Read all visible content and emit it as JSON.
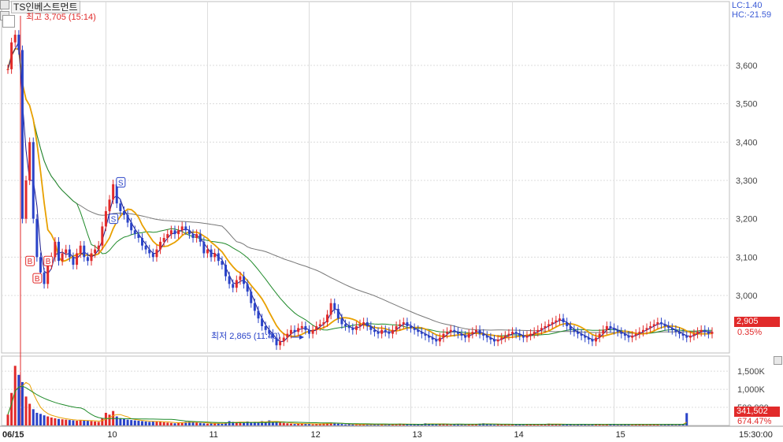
{
  "header": {
    "title": "TS인베스트먼트",
    "lc": "LC:1.40",
    "hc": "HC:-21.59"
  },
  "annotations": {
    "high": "최고 3,705 (15:14)",
    "low": "최저 2,865 (11:40)"
  },
  "price_panel": {
    "current_price": "2,905",
    "change_pct": "0.35%"
  },
  "volume_panel": {
    "current_volume": "341,502",
    "ratio_pct": "674.47%"
  },
  "colors": {
    "up": "#e12a2a",
    "down": "#2a43c8",
    "ma_short": "#1a1a8c",
    "ma_mid": "#e8a000",
    "ma_long": "#1f8a2a",
    "ma_longest": "#777777",
    "grid": "#dcdcdc"
  },
  "chart_data": [
    {
      "type": "line",
      "title": "TS인베스트먼트",
      "y_ticks": [
        3000,
        3100,
        3200,
        3300,
        3400,
        3500,
        3600
      ],
      "y_tick_labels": [
        "3,000",
        "3,100",
        "3,200",
        "3,300",
        "3,400",
        "3,500",
        "3,600"
      ],
      "ylim": [
        2850,
        3750
      ],
      "x_tick_labels": [
        "06/15",
        "10",
        "11",
        "12",
        "13",
        "14",
        "15"
      ],
      "x_time_label": "15:30:00",
      "grid": true,
      "high": 3705,
      "low": 2865,
      "last": 2905,
      "markers": [
        {
          "label": "B",
          "x_index": 6,
          "y": 3090
        },
        {
          "label": "B",
          "x_index": 8,
          "y": 3045
        },
        {
          "label": "B",
          "x_index": 11,
          "y": 3090
        },
        {
          "label": "S",
          "x_index": 29,
          "y": 3200
        },
        {
          "label": "S",
          "x_index": 31,
          "y": 3295
        }
      ],
      "series": [
        {
          "x_index": [
            0,
            1,
            2,
            3,
            4,
            5,
            6,
            7,
            8,
            9,
            10,
            11,
            12,
            13,
            14,
            15,
            16,
            17,
            18,
            19,
            20,
            21,
            22,
            23,
            24,
            25,
            26,
            27,
            28,
            29,
            30,
            31,
            32,
            33,
            34,
            35,
            36,
            37,
            38,
            39,
            40,
            41,
            42,
            43,
            44,
            45,
            46,
            47,
            48,
            49,
            50,
            51,
            52,
            53,
            54,
            55,
            56,
            57,
            58,
            59,
            60,
            61,
            62,
            63,
            64,
            65,
            66,
            67,
            68,
            69,
            70,
            71,
            72,
            73,
            74,
            75,
            76,
            77,
            78,
            79,
            80,
            81,
            82,
            83,
            84,
            85,
            86,
            87,
            88,
            89,
            90,
            91,
            92,
            93,
            94,
            95,
            96,
            97,
            98,
            99,
            100,
            101,
            102,
            103,
            104,
            105,
            106,
            107,
            108,
            109,
            110,
            111,
            112,
            113,
            114,
            115,
            116,
            117,
            118,
            119,
            120,
            121,
            122,
            123,
            124,
            125,
            126,
            127,
            128,
            129,
            130,
            131,
            132,
            133,
            134,
            135,
            136,
            137,
            138,
            139,
            140,
            141,
            142,
            143,
            144,
            145,
            146,
            147,
            148,
            149,
            150,
            151,
            152,
            153,
            154,
            155,
            156,
            157,
            158,
            159,
            160,
            161,
            162,
            163,
            164,
            165,
            166,
            167,
            168,
            169,
            170,
            171,
            172,
            173,
            174,
            175,
            176,
            177,
            178,
            179,
            180,
            181,
            182,
            183,
            184,
            185,
            186,
            187,
            188,
            189,
            190,
            191,
            192,
            193,
            194
          ],
          "values": [
            3590,
            3660,
            3680,
            3640,
            3200,
            3300,
            3400,
            3200,
            3100,
            3060,
            3030,
            3080,
            3100,
            3140,
            3090,
            3110,
            3120,
            3100,
            3080,
            3110,
            3130,
            3100,
            3090,
            3110,
            3120,
            3130,
            3180,
            3220,
            3250,
            3290,
            3240,
            3220,
            3210,
            3190,
            3170,
            3160,
            3150,
            3130,
            3120,
            3110,
            3100,
            3120,
            3140,
            3150,
            3160,
            3170,
            3160,
            3170,
            3180,
            3170,
            3160,
            3150,
            3160,
            3140,
            3110,
            3120,
            3100,
            3110,
            3090,
            3080,
            3050,
            3030,
            3020,
            3040,
            3050,
            3030,
            3010,
            2980,
            2960,
            2940,
            2920,
            2910,
            2900,
            2890,
            2870,
            2880,
            2890,
            2900,
            2910,
            2905,
            2915,
            2920,
            2910,
            2900,
            2910,
            2920,
            2925,
            2930,
            2950,
            2980,
            2965,
            2940,
            2925,
            2920,
            2915,
            2910,
            2920,
            2925,
            2930,
            2920,
            2910,
            2905,
            2900,
            2910,
            2905,
            2900,
            2910,
            2920,
            2925,
            2930,
            2920,
            2915,
            2910,
            2905,
            2900,
            2895,
            2890,
            2885,
            2880,
            2890,
            2900,
            2905,
            2910,
            2905,
            2900,
            2895,
            2890,
            2900,
            2905,
            2910,
            2900,
            2895,
            2890,
            2885,
            2880,
            2885,
            2890,
            2895,
            2900,
            2905,
            2900,
            2895,
            2890,
            2895,
            2900,
            2905,
            2910,
            2915,
            2920,
            2925,
            2930,
            2935,
            2940,
            2930,
            2920,
            2910,
            2905,
            2900,
            2895,
            2890,
            2885,
            2880,
            2890,
            2900,
            2910,
            2920,
            2915,
            2910,
            2905,
            2900,
            2895,
            2890,
            2895,
            2900,
            2905,
            2910,
            2915,
            2920,
            2925,
            2930,
            2925,
            2920,
            2915,
            2910,
            2905,
            2900,
            2895,
            2890,
            2895,
            2900,
            2905,
            2910,
            2905,
            2900,
            2905
          ]
        }
      ]
    },
    {
      "type": "bar",
      "title": "",
      "y_ticks": [
        500000,
        1000000,
        1500000
      ],
      "y_tick_labels": [
        "500,000",
        "1,000K",
        "1,500K"
      ],
      "ylim": [
        0,
        1700000
      ],
      "series": [
        {
          "x_index": [
            0,
            1,
            2,
            3,
            4,
            5,
            6,
            7,
            8,
            9,
            10,
            11,
            12,
            13,
            14,
            15,
            16,
            17,
            18,
            19,
            20,
            21,
            22,
            23,
            24,
            25,
            26,
            27,
            28,
            29,
            30,
            31,
            32,
            33,
            34,
            35,
            36,
            37,
            38,
            39,
            40,
            41,
            42,
            43,
            44,
            45,
            46,
            47,
            48,
            49,
            50,
            51,
            52,
            53,
            54,
            55,
            56,
            57,
            58,
            59,
            60,
            61,
            62,
            63,
            64,
            65,
            66,
            67,
            68,
            69,
            70,
            71,
            72,
            73,
            74,
            75,
            76,
            77,
            78,
            79,
            80,
            81,
            82,
            83,
            84,
            85,
            86,
            87,
            88,
            89,
            90,
            91,
            92,
            93,
            94,
            95,
            96,
            97,
            98,
            99,
            100,
            101,
            102,
            103,
            104,
            105,
            106,
            107,
            108,
            109,
            110,
            111,
            112,
            113,
            114,
            115,
            116,
            117,
            118,
            119,
            120,
            121,
            122,
            123,
            124,
            125,
            126,
            127,
            128,
            129,
            130,
            131,
            132,
            133,
            134,
            135,
            136,
            137,
            138,
            139,
            140,
            141,
            142,
            143,
            144,
            145,
            146,
            147,
            148,
            149,
            150,
            151,
            152,
            153,
            154,
            155,
            156,
            157,
            158,
            159,
            160,
            161,
            162,
            163,
            164,
            165,
            166,
            167,
            168,
            169,
            170,
            171,
            172,
            173,
            174,
            175,
            176,
            177,
            178,
            179,
            180,
            181,
            182,
            183,
            184,
            185,
            186,
            187,
            188,
            189,
            190,
            191,
            192,
            193,
            194
          ],
          "values": [
            300000,
            900000,
            1650000,
            1400000,
            1200000,
            800000,
            600000,
            450000,
            350000,
            320000,
            280000,
            250000,
            220000,
            200000,
            180000,
            170000,
            160000,
            150000,
            140000,
            130000,
            150000,
            140000,
            130000,
            120000,
            110000,
            100000,
            200000,
            350000,
            300000,
            400000,
            250000,
            200000,
            180000,
            160000,
            150000,
            140000,
            130000,
            120000,
            110000,
            100000,
            120000,
            110000,
            100000,
            90000,
            80000,
            70000,
            60000,
            80000,
            90000,
            100000,
            110000,
            90000,
            80000,
            70000,
            60000,
            50000,
            60000,
            70000,
            60000,
            50000,
            80000,
            120000,
            100000,
            90000,
            80000,
            70000,
            110000,
            90000,
            100000,
            80000,
            120000,
            100000,
            140000,
            110000,
            90000,
            80000,
            70000,
            60000,
            50000,
            40000,
            50000,
            60000,
            50000,
            40000,
            30000,
            40000,
            50000,
            60000,
            70000,
            80000,
            60000,
            50000,
            40000,
            30000,
            40000,
            30000,
            20000,
            30000,
            40000,
            30000,
            20000,
            30000,
            40000,
            30000,
            20000,
            30000,
            40000,
            30000,
            50000,
            40000,
            30000,
            20000,
            30000,
            40000,
            30000,
            60000,
            50000,
            40000,
            30000,
            40000,
            50000,
            30000,
            20000,
            30000,
            40000,
            30000,
            20000,
            30000,
            40000,
            30000,
            50000,
            60000,
            40000,
            30000,
            20000,
            30000,
            40000,
            30000,
            20000,
            30000,
            40000,
            30000,
            20000,
            30000,
            40000,
            30000,
            20000,
            30000,
            40000,
            50000,
            40000,
            30000,
            20000,
            30000,
            40000,
            30000,
            20000,
            30000,
            40000,
            30000,
            20000,
            30000,
            40000,
            30000,
            20000,
            30000,
            40000,
            30000,
            20000,
            30000,
            40000,
            30000,
            20000,
            30000,
            40000,
            30000,
            20000,
            30000,
            40000,
            30000,
            20000,
            30000,
            40000,
            30000,
            20000,
            30000,
            40000,
            341502
          ]
        }
      ]
    }
  ]
}
